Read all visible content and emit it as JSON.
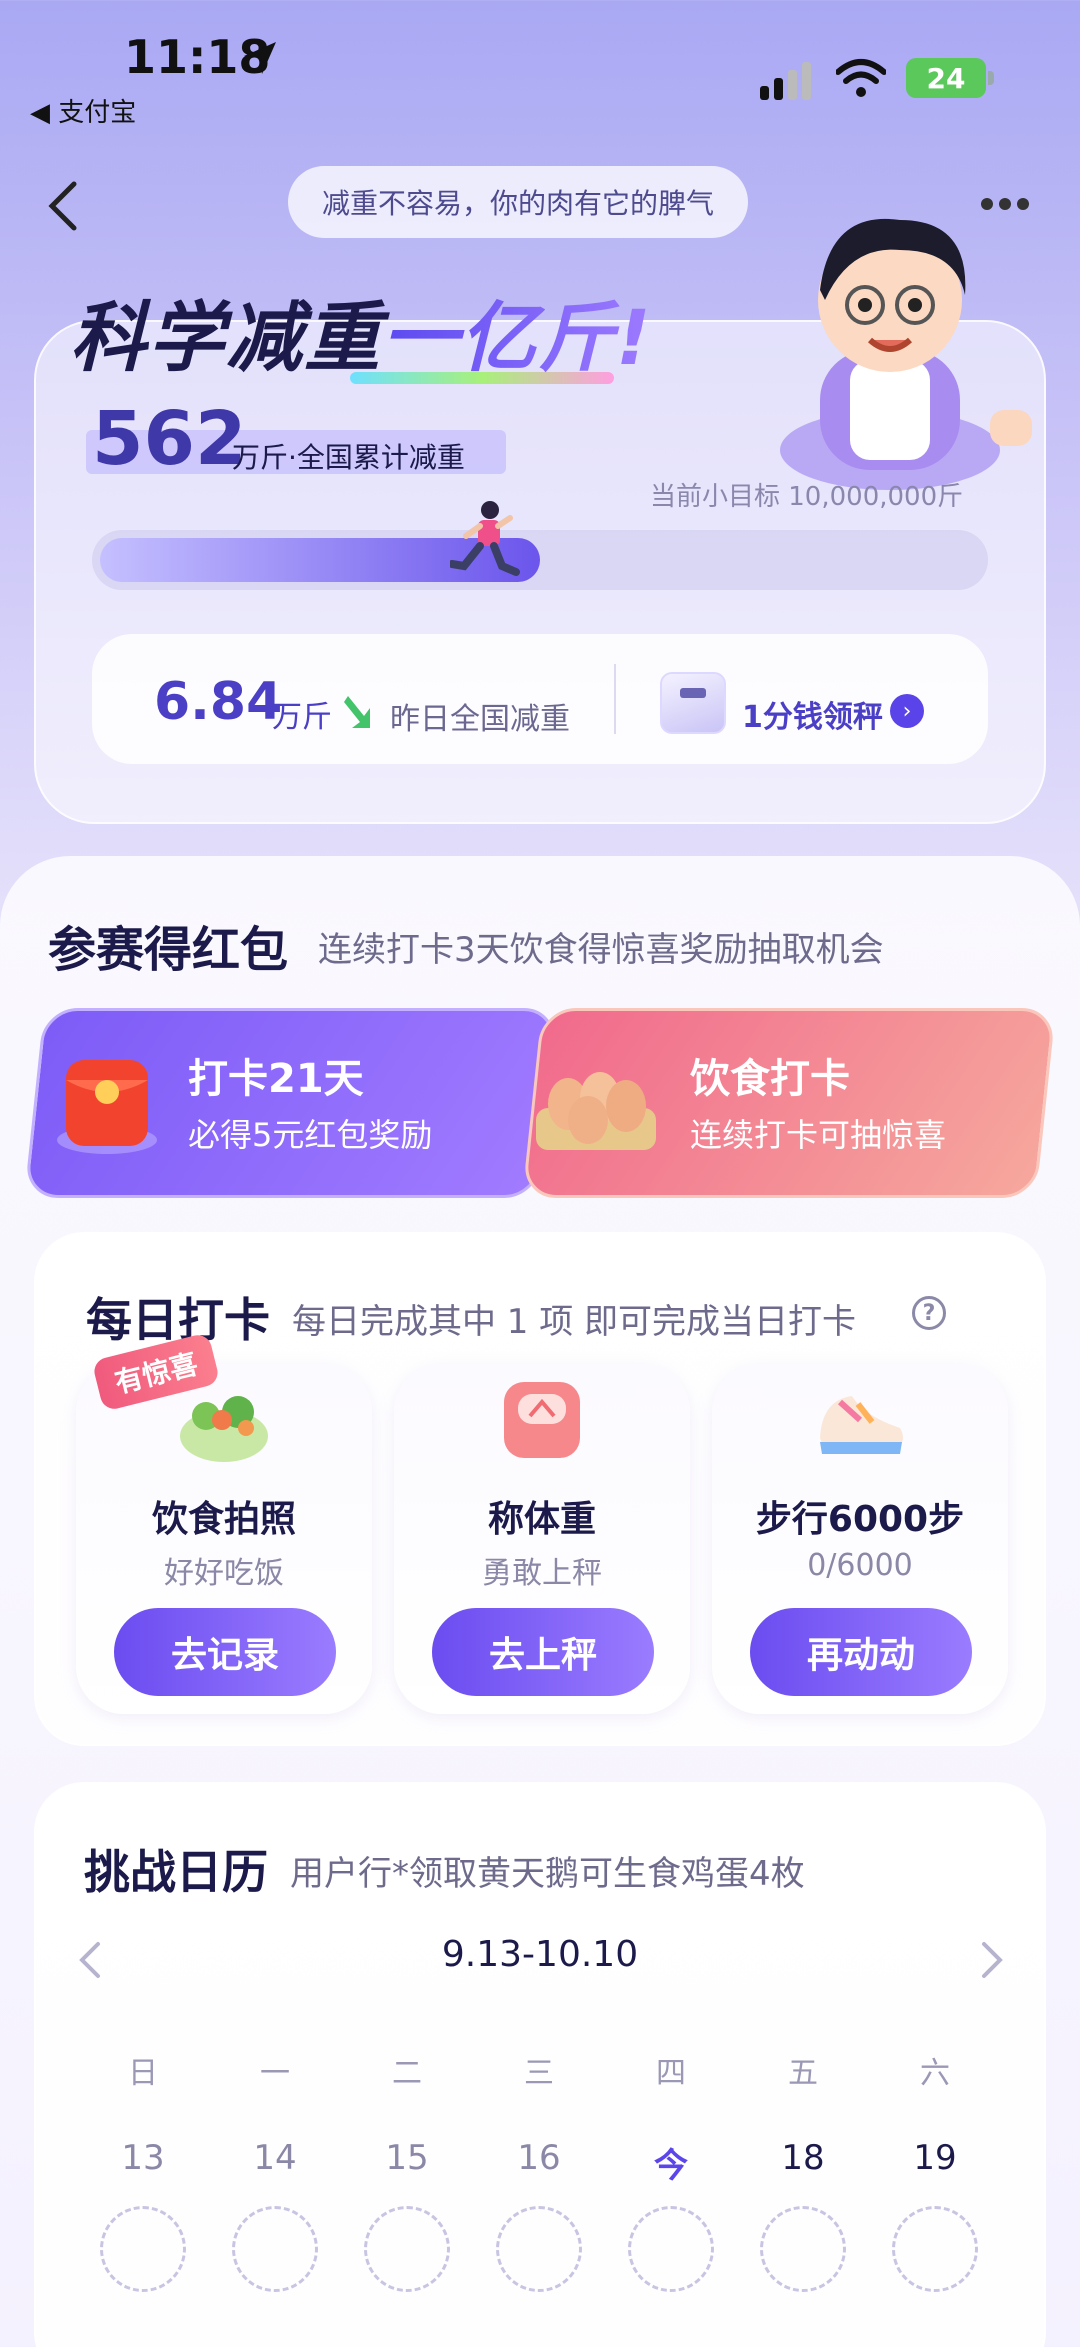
{
  "status_bar": {
    "time": "11:18",
    "back_app": "◀ 支付宝",
    "battery": "24"
  },
  "nav": {
    "slogan": "减重不容易，你的肉有它的脾气"
  },
  "hero": {
    "headline_plain": "科学减重",
    "headline_highlight": "一亿斤!",
    "total_number": "562",
    "total_label": "万斤·全国累计减重",
    "target": "当前小目标 10,000,000斤",
    "progress_fraction": 0.5,
    "yesterday_number": "6.84",
    "yesterday_unit": "万斤",
    "yesterday_label": "昨日全国减重",
    "claim_label": "1分钱领秤"
  },
  "contest": {
    "title": "参赛得红包",
    "subtitle": "连续打卡3天饮食得惊喜奖励抽取机会",
    "left_banner": {
      "title": "打卡21天",
      "subtitle": "必得5元红包奖励"
    },
    "right_banner": {
      "title": "饮食打卡",
      "subtitle": "连续打卡可抽惊喜"
    }
  },
  "daily": {
    "title": "每日打卡",
    "subtitle": "每日完成其中 1 项 即可完成当日打卡",
    "surprise_badge": "有惊喜",
    "tasks": [
      {
        "name": "饮食拍照",
        "desc": "好好吃饭",
        "button": "去记录",
        "icon": "salad-icon"
      },
      {
        "name": "称体重",
        "desc": "勇敢上秤",
        "button": "去上秤",
        "icon": "scale-icon"
      },
      {
        "name": "步行6000步",
        "desc": "0/6000",
        "button": "再动动",
        "icon": "sneaker-icon"
      }
    ]
  },
  "calendar": {
    "title": "挑战日历",
    "subtitle": "用户行*领取黄天鹅可生食鸡蛋4枚",
    "range": "9.13-10.10",
    "weekdays": [
      "日",
      "一",
      "二",
      "三",
      "四",
      "五",
      "六"
    ],
    "days": [
      "13",
      "14",
      "15",
      "16",
      "今",
      "18",
      "19"
    ]
  },
  "colors": {
    "accent": "#5b46ec",
    "banner_purple": "#7d5cf7",
    "banner_pink": "#f16a8c"
  }
}
